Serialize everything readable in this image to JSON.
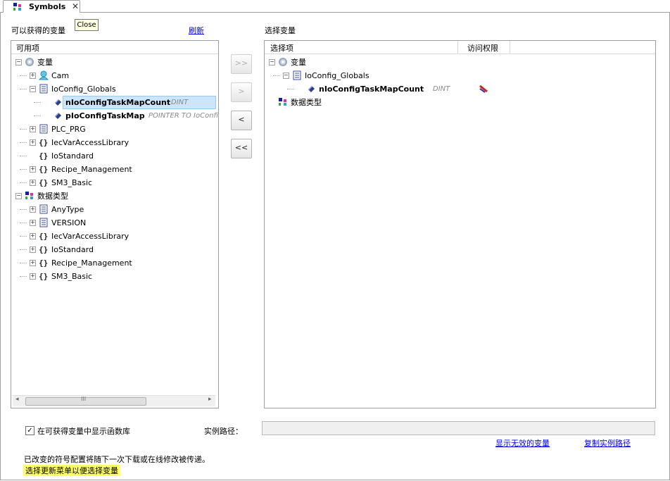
{
  "tab": {
    "title": "Symbols",
    "close_glyph": "✕",
    "tooltip": "Close"
  },
  "left": {
    "title": "可以获得的变量",
    "refresh": "刷新",
    "column": "可用项",
    "tree": [
      {
        "label": "变量",
        "icon": "gear-icon",
        "expander": "−",
        "bold": false
      },
      {
        "label": "Cam",
        "icon": "people-icon",
        "expander": "+"
      },
      {
        "label": "IoConfig_Globals",
        "icon": "document-icon",
        "expander": "−"
      },
      {
        "label": "nIoConfigTaskMapCount",
        "type": "DINT",
        "icon": "variable-icon",
        "selected": true
      },
      {
        "label": "pIoConfigTaskMap",
        "type": "POINTER TO IoConfi",
        "icon": "variable-icon"
      },
      {
        "label": "PLC_PRG",
        "icon": "document-icon",
        "expander": "+"
      },
      {
        "label": "IecVarAccessLibrary",
        "icon": "braces-icon",
        "expander": "+"
      },
      {
        "label": "IoStandard",
        "icon": "braces-icon"
      },
      {
        "label": "Recipe_Management",
        "icon": "braces-icon",
        "expander": "+"
      },
      {
        "label": "SM3_Basic",
        "icon": "braces-icon",
        "expander": "+"
      },
      {
        "label": "数据类型",
        "icon": "datatype-icon",
        "expander": "−"
      },
      {
        "label": "AnyType",
        "icon": "document-icon",
        "expander": "+"
      },
      {
        "label": "VERSION",
        "icon": "document-icon",
        "expander": "+"
      },
      {
        "label": "IecVarAccessLibrary",
        "icon": "braces-icon",
        "expander": "+"
      },
      {
        "label": "IoStandard",
        "icon": "braces-icon",
        "expander": "+"
      },
      {
        "label": "Recipe_Management",
        "icon": "braces-icon",
        "expander": "+"
      },
      {
        "label": "SM3_Basic",
        "icon": "braces-icon",
        "expander": "+"
      }
    ],
    "scroll_glyphs": {
      "left": "◂",
      "right": "▸",
      "thumb": "III"
    }
  },
  "buttons": {
    "add_all": ">>",
    "add": ">",
    "remove": "<",
    "remove_all": "<<"
  },
  "right": {
    "title": "选择变量",
    "col_selected": "选择项",
    "col_access": "访问权限",
    "tree": [
      {
        "label": "变量",
        "icon": "gear-icon",
        "expander": "−"
      },
      {
        "label": "IoConfig_Globals",
        "icon": "document-icon",
        "expander": "−"
      },
      {
        "label": "nIoConfigTaskMapCount",
        "type": "DINT",
        "icon": "variable-icon"
      },
      {
        "label": "数据类型",
        "icon": "datatype-icon"
      }
    ]
  },
  "bottom": {
    "checkbox_label": "在可获得变量中显示函数库",
    "checkbox_checked": "✓",
    "instance_path_label": "实例路径：",
    "show_invalid": "显示无效的变量",
    "copy_path": "复制实例路径",
    "message1": "已改变的符号配置将随下一次下载或在线修改被传递。",
    "message2": "选择更新菜单以便选择变量"
  }
}
